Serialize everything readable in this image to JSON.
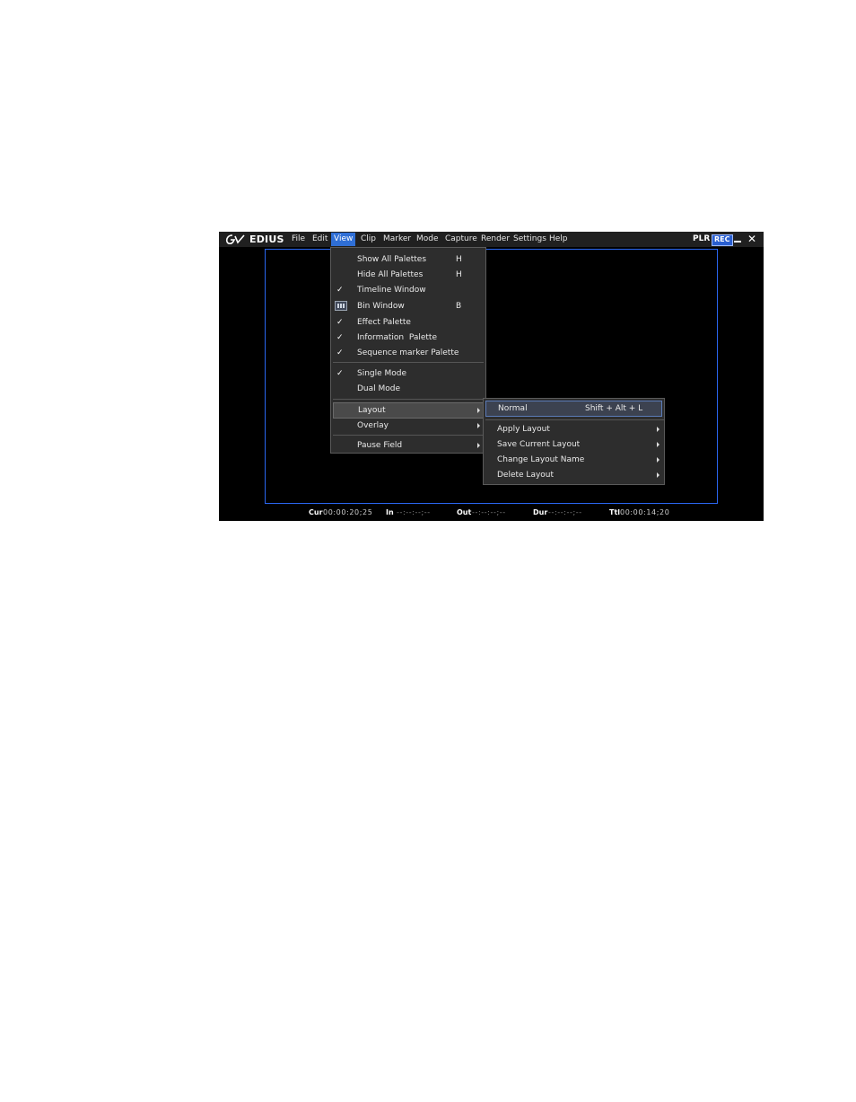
{
  "app": {
    "brand": "EDIUS"
  },
  "menubar": {
    "items": [
      {
        "label": "File"
      },
      {
        "label": "Edit"
      },
      {
        "label": "View"
      },
      {
        "label": "Clip"
      },
      {
        "label": "Marker"
      },
      {
        "label": "Mode"
      },
      {
        "label": "Capture"
      },
      {
        "label": "Render"
      },
      {
        "label": "Settings"
      },
      {
        "label": "Help"
      }
    ],
    "active": "View",
    "plr": "PLR",
    "rec": "REC",
    "close": "✕"
  },
  "view_menu": {
    "items": [
      {
        "label": "Show All Palettes",
        "shortcut": "H",
        "checked": false
      },
      {
        "label": "Hide All Palettes",
        "shortcut": "H",
        "checked": false
      },
      {
        "label": "Timeline Window",
        "shortcut": "",
        "checked": true
      },
      {
        "label": "Bin Window",
        "shortcut": "B",
        "icon": "bin-icon"
      },
      {
        "label": "Effect Palette",
        "shortcut": "",
        "checked": true
      },
      {
        "label": "Information  Palette",
        "shortcut": "",
        "checked": true
      },
      {
        "label": "Sequence marker Palette",
        "shortcut": "",
        "checked": true
      },
      {
        "label": "Single Mode",
        "checked": true
      },
      {
        "label": "Dual Mode",
        "checked": false
      },
      {
        "label": "Layout",
        "submenu": true,
        "highlighted": true
      },
      {
        "label": "Overlay",
        "submenu": true
      },
      {
        "label": "Pause Field",
        "submenu": true
      }
    ],
    "check_mark": "✓"
  },
  "layout_submenu": {
    "items": [
      {
        "label": "Normal",
        "shortcut": "Shift + Alt + L",
        "highlighted": true
      },
      {
        "label": "Apply Layout",
        "submenu": true
      },
      {
        "label": "Save Current Layout",
        "submenu": true
      },
      {
        "label": "Change Layout Name",
        "submenu": true
      },
      {
        "label": "Delete Layout",
        "submenu": true
      }
    ]
  },
  "status": {
    "cur_label": "Cur",
    "cur": "00:00:20;25",
    "in_label": "In",
    "in": "--:--:--;--",
    "out_label": "Out",
    "out": "--:--:--;--",
    "dur_label": "Dur",
    "dur": "--:--:--;--",
    "ttl_label": "Ttl",
    "ttl": "00:00:14;20"
  },
  "colors": {
    "accent": "#2a66f0",
    "menu_bg": "#2d2d2d",
    "active_menu": "#2f6fd6"
  }
}
